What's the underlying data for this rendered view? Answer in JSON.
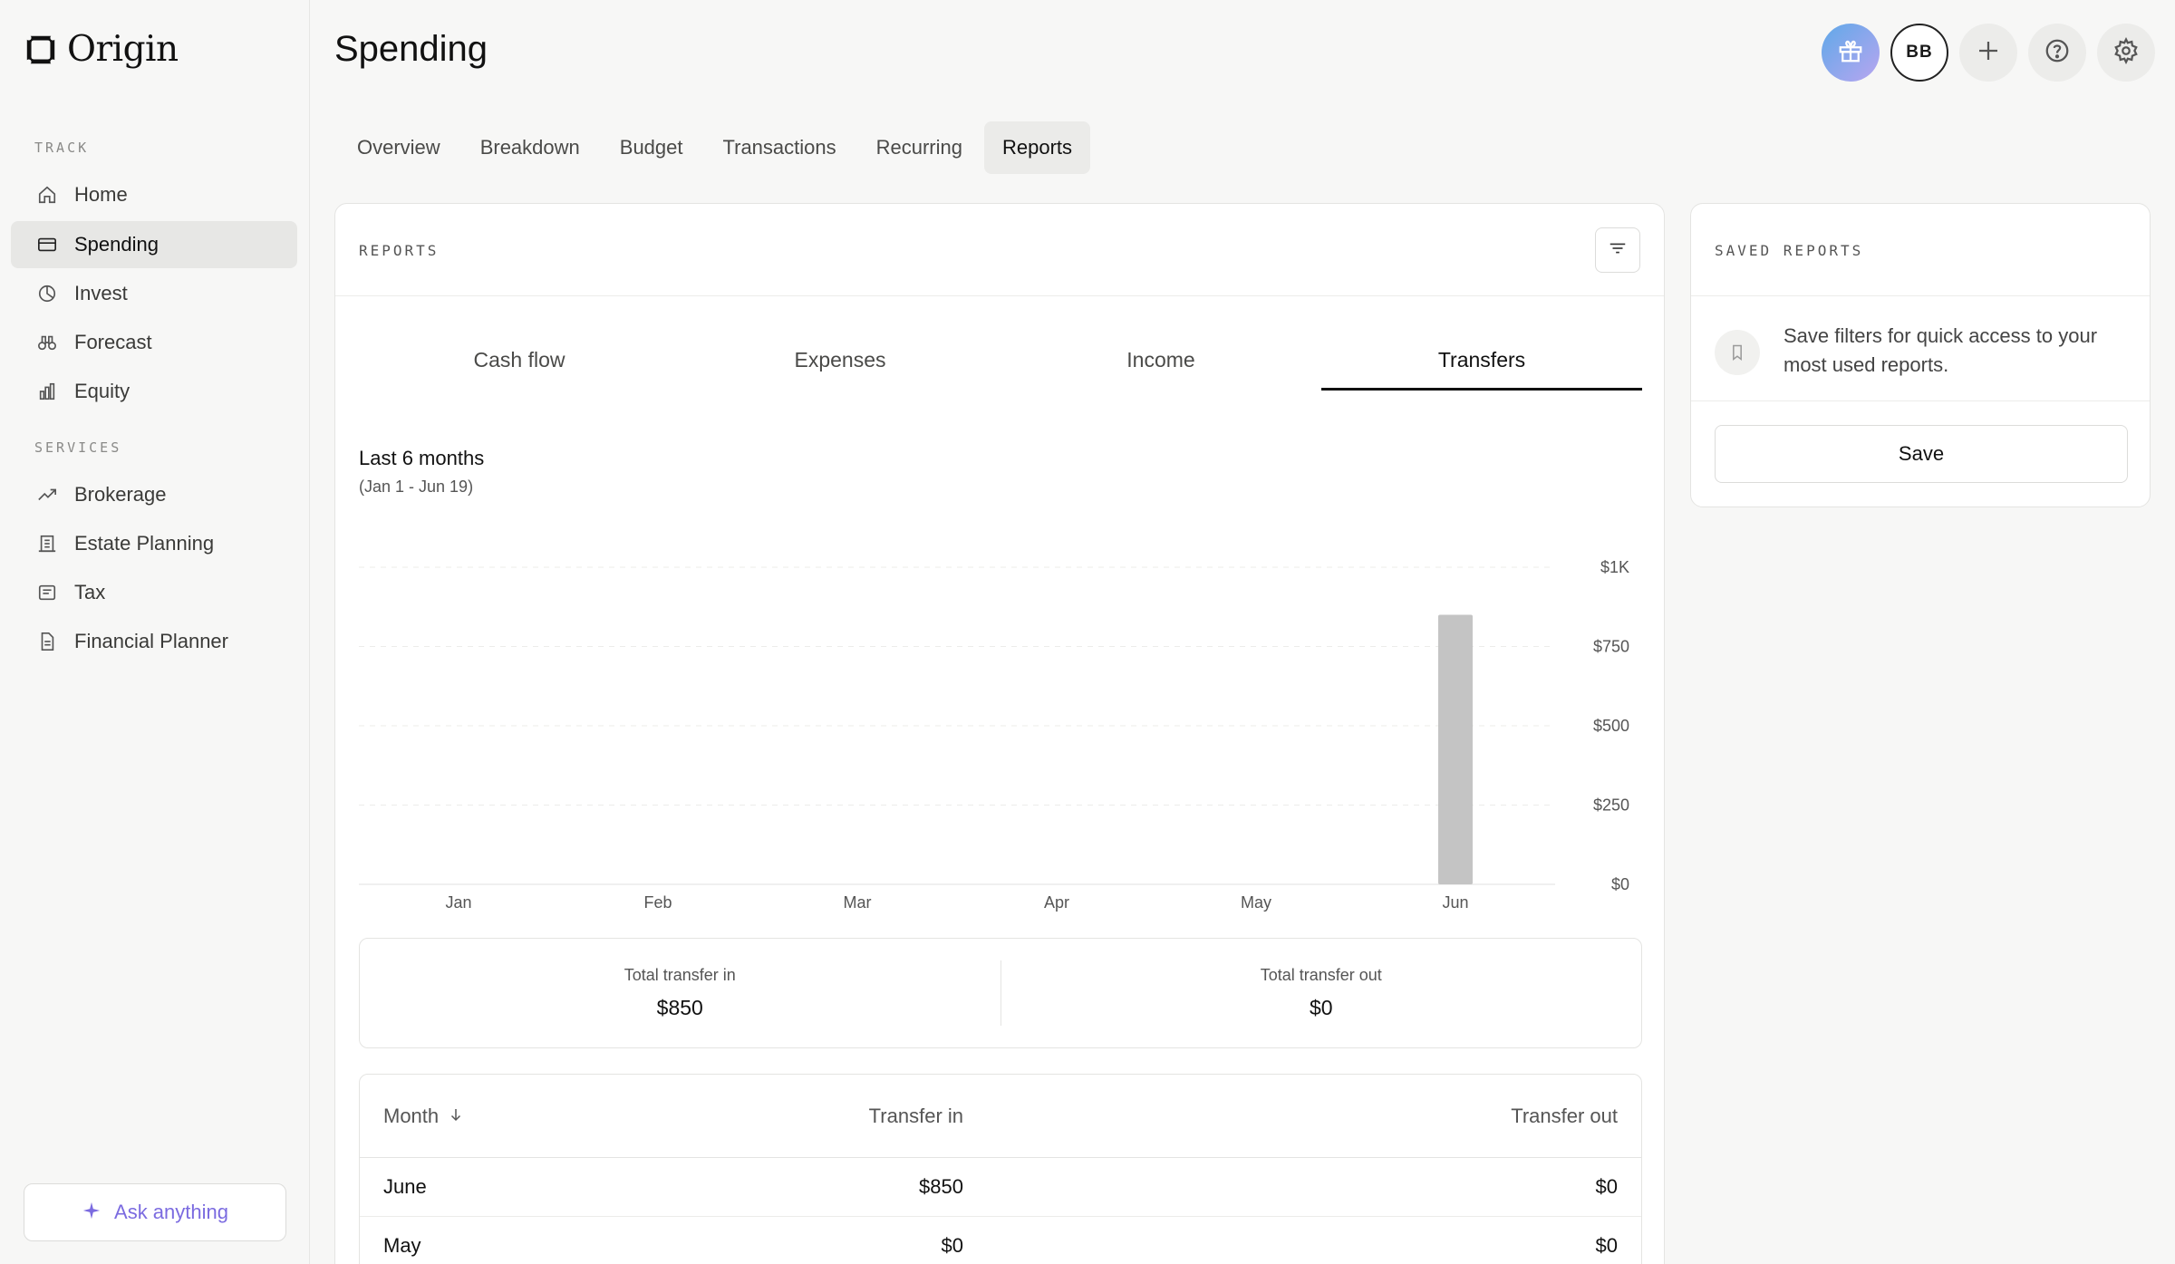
{
  "app": {
    "name": "Origin"
  },
  "sidebar": {
    "track_label": "TRACK",
    "services_label": "SERVICES",
    "track_items": [
      {
        "label": "Home",
        "icon": "home-icon"
      },
      {
        "label": "Spending",
        "icon": "card-icon",
        "active": true
      },
      {
        "label": "Invest",
        "icon": "pie-icon"
      },
      {
        "label": "Forecast",
        "icon": "binoculars-icon"
      },
      {
        "label": "Equity",
        "icon": "bar-chart-icon"
      }
    ],
    "service_items": [
      {
        "label": "Brokerage",
        "icon": "trend-up-icon"
      },
      {
        "label": "Estate Planning",
        "icon": "building-icon"
      },
      {
        "label": "Tax",
        "icon": "receipt-icon"
      },
      {
        "label": "Financial Planner",
        "icon": "document-icon"
      }
    ],
    "ask_label": "Ask anything"
  },
  "header": {
    "title": "Spending",
    "avatar_initials": "BB",
    "tabs": [
      {
        "label": "Overview"
      },
      {
        "label": "Breakdown"
      },
      {
        "label": "Budget"
      },
      {
        "label": "Transactions"
      },
      {
        "label": "Recurring"
      },
      {
        "label": "Reports",
        "active": true
      }
    ]
  },
  "reports": {
    "label": "REPORTS",
    "subtabs": [
      {
        "label": "Cash flow"
      },
      {
        "label": "Expenses"
      },
      {
        "label": "Income"
      },
      {
        "label": "Transfers",
        "active": true
      }
    ],
    "period_title": "Last 6 months",
    "period_range": "(Jan 1 - Jun 19)",
    "summary": {
      "in_label": "Total transfer in",
      "in_value": "$850",
      "out_label": "Total transfer out",
      "out_value": "$0"
    },
    "table": {
      "headers": [
        "Month",
        "Transfer in",
        "Transfer out"
      ],
      "rows": [
        [
          "June",
          "$850",
          "$0"
        ],
        [
          "May",
          "$0",
          "$0"
        ]
      ]
    }
  },
  "chart_data": {
    "type": "bar",
    "categories": [
      "Jan",
      "Feb",
      "Mar",
      "Apr",
      "May",
      "Jun"
    ],
    "values": [
      0,
      0,
      0,
      0,
      0,
      850
    ],
    "y_ticks": [
      "$1K",
      "$750",
      "$500",
      "$250",
      "$0"
    ],
    "ylim": [
      0,
      1000
    ],
    "grid": true,
    "bar_color": "#c4c4c4"
  },
  "saved_reports": {
    "label": "SAVED REPORTS",
    "empty_text": "Save filters for quick access to your most used reports.",
    "save_label": "Save"
  },
  "colors": {
    "accent": "#7b6be0",
    "active_bg": "#e7e7e5"
  }
}
